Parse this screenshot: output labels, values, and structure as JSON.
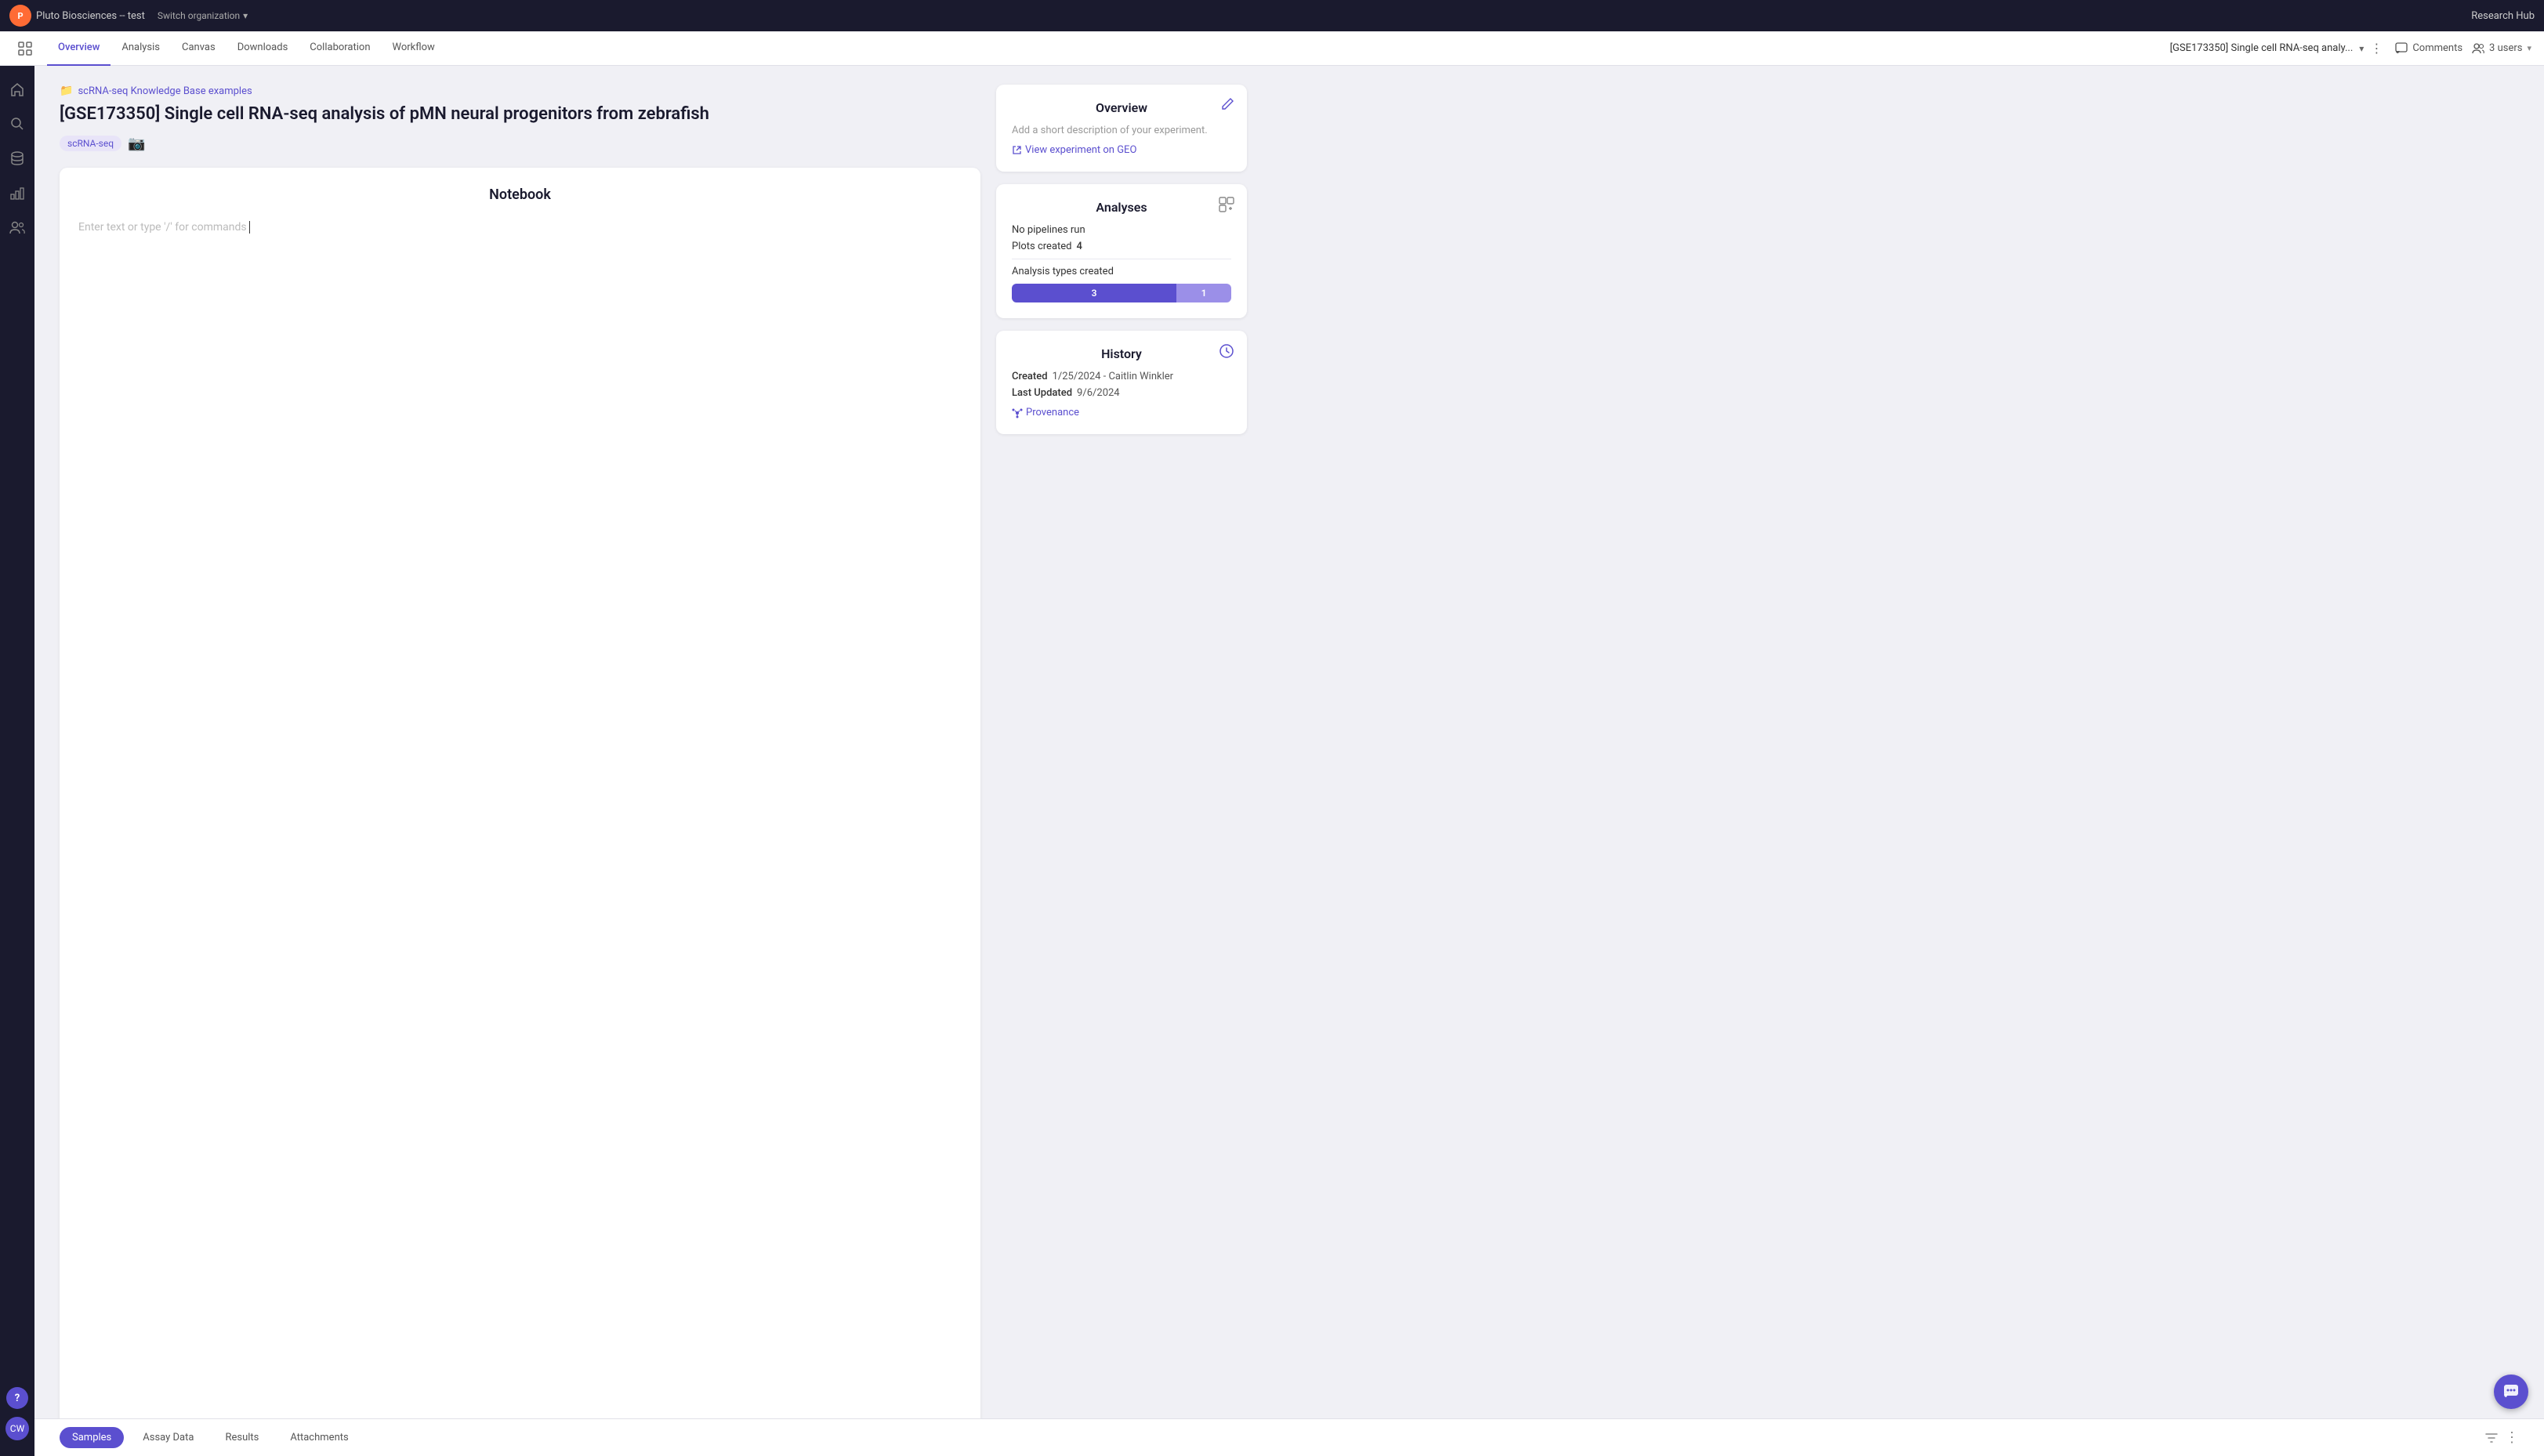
{
  "topbar": {
    "logo_text": "P",
    "org_name": "Pluto Biosciences -- test",
    "switch_label": "Switch organization",
    "research_hub": "Research Hub"
  },
  "navbar": {
    "tabs": [
      {
        "label": "Overview",
        "active": true
      },
      {
        "label": "Analysis",
        "active": false
      },
      {
        "label": "Canvas",
        "active": false
      },
      {
        "label": "Downloads",
        "active": false
      },
      {
        "label": "Collaboration",
        "active": false
      },
      {
        "label": "Workflow",
        "active": false
      }
    ],
    "project_title": "[GSE173350] Single cell RNA-seq analy...",
    "comments_label": "Comments",
    "users_label": "3 users"
  },
  "breadcrumb": {
    "text": "scRNA-seq Knowledge Base examples"
  },
  "page": {
    "title": "[GSE173350] Single cell RNA-seq analysis of pMN neural progenitors from zebrafish",
    "tag": "scRNA-seq"
  },
  "notebook": {
    "title": "Notebook",
    "placeholder": "Enter text or type '/' for commands"
  },
  "overview_card": {
    "title": "Overview",
    "description": "Add a short description of your experiment.",
    "geo_link": "View experiment on GEO"
  },
  "analyses_card": {
    "title": "Analyses",
    "no_pipelines": "No pipelines run",
    "plots_label": "Plots created",
    "plots_value": "4",
    "analysis_types_label": "Analysis types created",
    "bar_value_1": "3",
    "bar_value_2": "1"
  },
  "history_card": {
    "title": "History",
    "created_label": "Created",
    "created_value": "1/25/2024 - Caitlin Winkler",
    "updated_label": "Last Updated",
    "updated_value": "9/6/2024",
    "provenance_label": "Provenance"
  },
  "bottom_tabs": {
    "tabs": [
      {
        "label": "Samples",
        "active": true
      },
      {
        "label": "Assay Data",
        "active": false
      },
      {
        "label": "Results",
        "active": false
      },
      {
        "label": "Attachments",
        "active": false
      }
    ]
  },
  "help": {
    "label": "?"
  },
  "chat": {
    "icon": "💬"
  }
}
